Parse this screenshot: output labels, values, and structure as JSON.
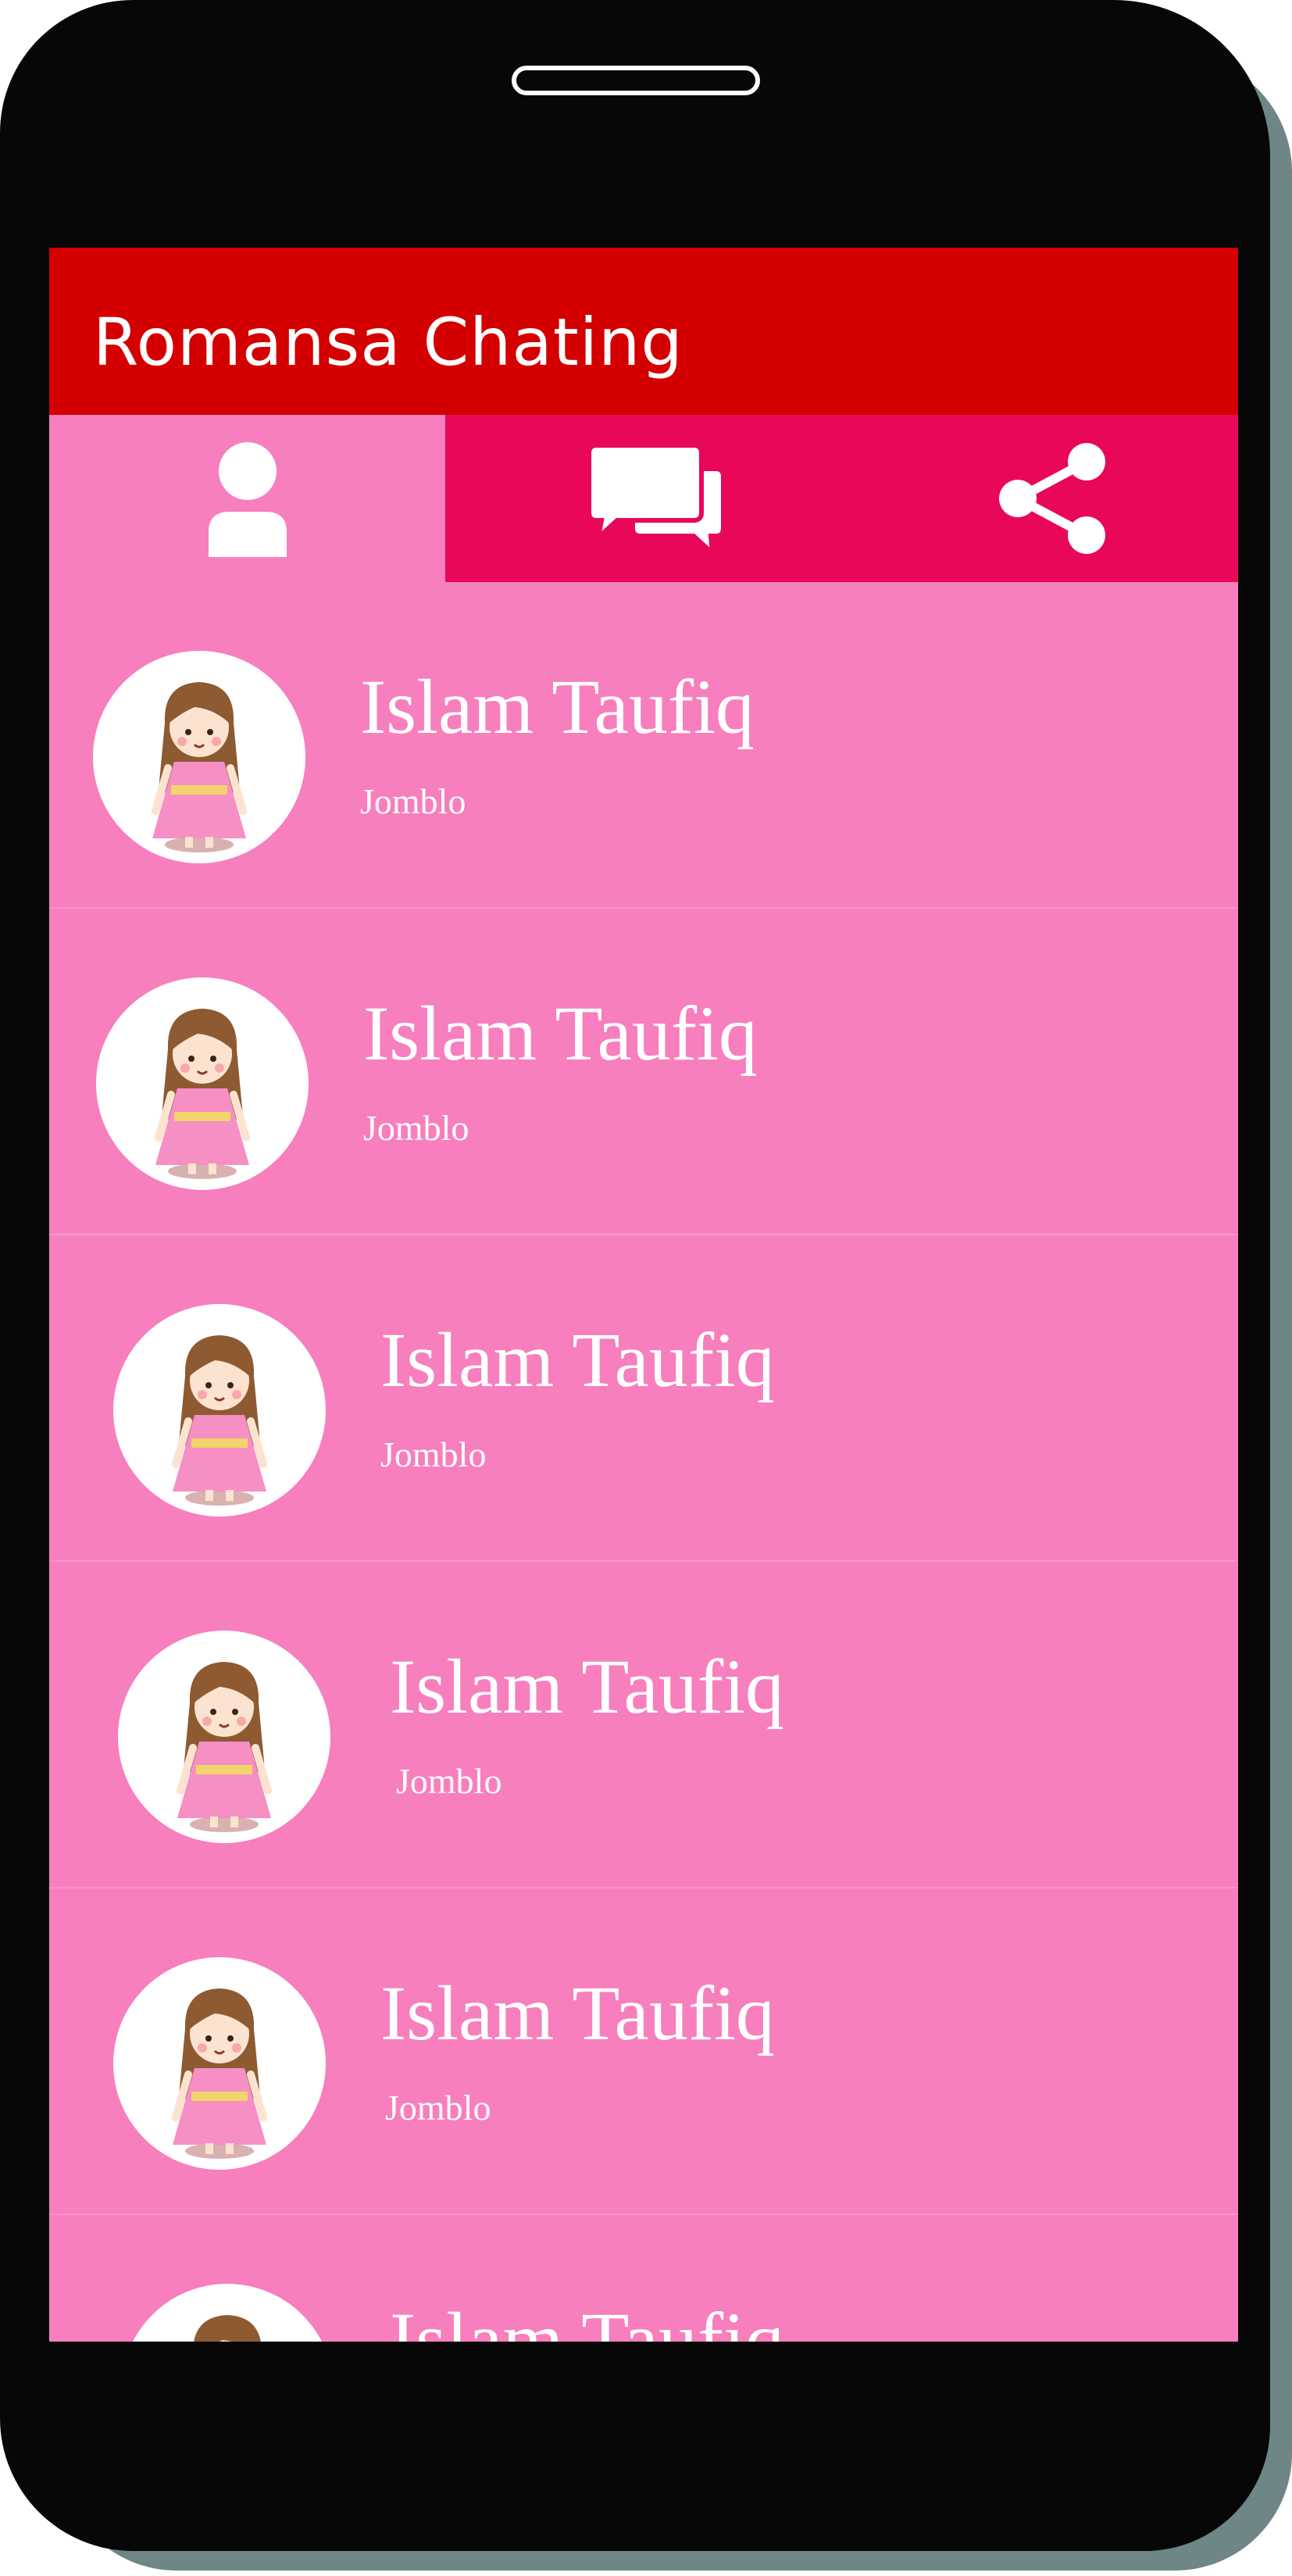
{
  "app": {
    "title": "Romansa Chating"
  },
  "tabs": [
    {
      "icon": "person-icon",
      "active": true
    },
    {
      "icon": "chat-bubbles-icon",
      "active": false
    },
    {
      "icon": "share-icon",
      "active": false
    }
  ],
  "contacts": [
    {
      "name": "Islam Taufiq",
      "status": "Jomblo"
    },
    {
      "name": "Islam Taufiq",
      "status": "Jomblo"
    },
    {
      "name": "Islam Taufiq",
      "status": "Jomblo"
    },
    {
      "name": "Islam Taufiq",
      "status": "Jomblo"
    },
    {
      "name": "Islam Taufiq",
      "status": "Jomblo"
    },
    {
      "name": "Islam Taufiq",
      "status": ""
    }
  ],
  "colors": {
    "appbar": "#d40000",
    "tabbar": "#e9075a",
    "screen_bg": "#f77fbd",
    "phone": "#070707",
    "phone_shadow": "#6f8686"
  }
}
